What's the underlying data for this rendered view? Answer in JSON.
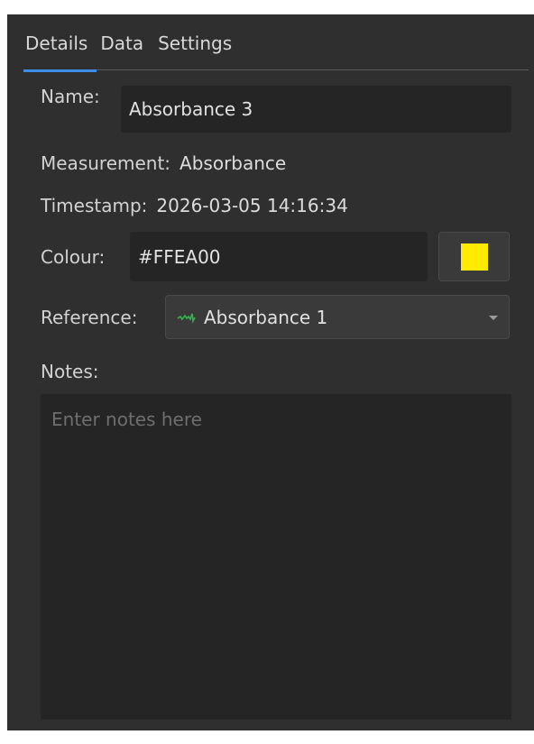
{
  "tabs": [
    {
      "label": "Details",
      "active": true
    },
    {
      "label": "Data",
      "active": false
    },
    {
      "label": "Settings",
      "active": false
    }
  ],
  "details": {
    "name_label": "Name:",
    "name_value": "Absorbance 3",
    "measurement_label": "Measurement:",
    "measurement_value": "Absorbance",
    "timestamp_label": "Timestamp:",
    "timestamp_value": "2026-03-05 14:16:34",
    "colour_label": "Colour:",
    "colour_value": "#FFEA00",
    "swatch_color": "#FFEA00",
    "reference_label": "Reference:",
    "reference_value": "Absorbance 1",
    "reference_icon": "green-spectrum-line-icon",
    "reference_icon_color": "#2fb84a",
    "notes_label": "Notes:",
    "notes_placeholder": "Enter notes here"
  },
  "colors": {
    "panel_bg": "#2f2f2f",
    "field_bg": "#252525",
    "accent": "#3d8ee6"
  }
}
